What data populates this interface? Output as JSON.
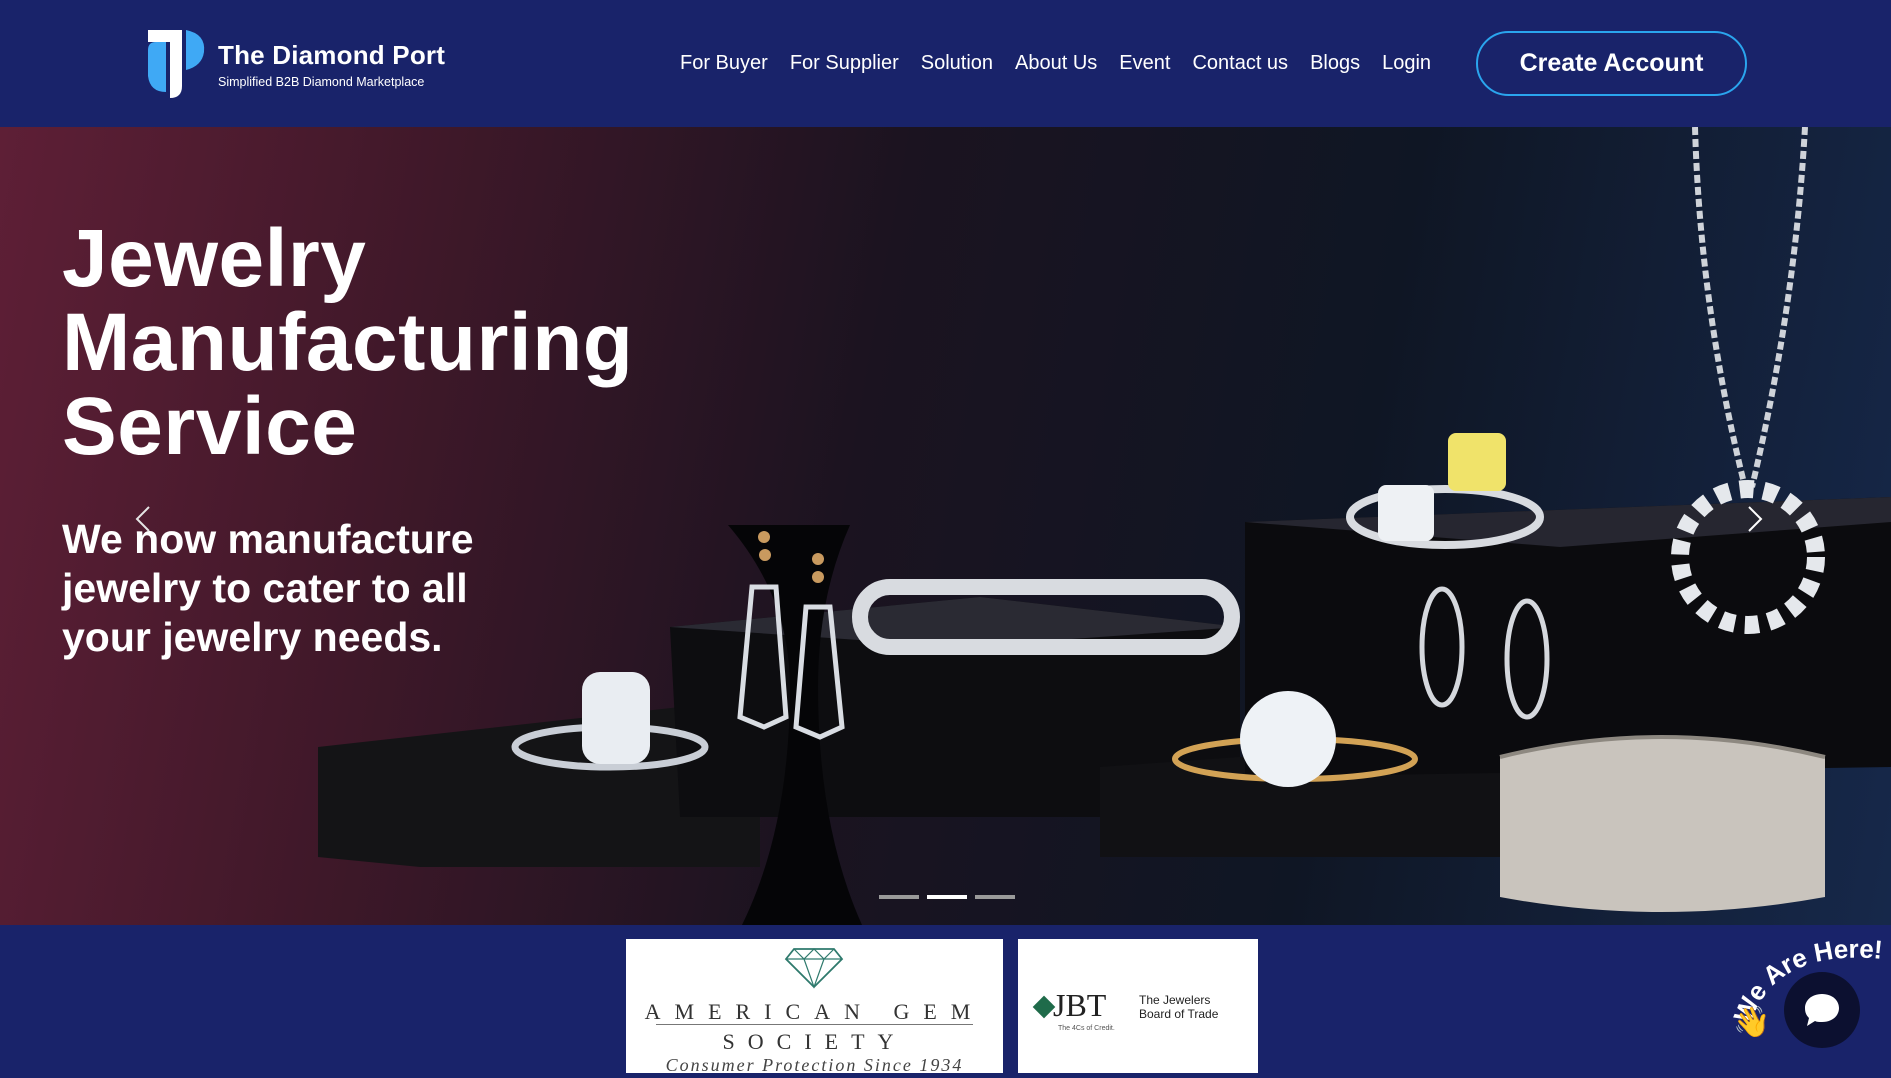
{
  "brand": {
    "name": "The Diamond Port",
    "tagline": "Simplified B2B Diamond Marketplace"
  },
  "nav": {
    "items": [
      "For Buyer",
      "For Supplier",
      "Solution",
      "About Us",
      "Event",
      "Contact us",
      "Blogs",
      "Login"
    ],
    "cta": "Create Account"
  },
  "hero": {
    "title_lines": [
      "Jewelry",
      "Manufacturing",
      "Service"
    ],
    "subtitle_lines": [
      "We now manufacture",
      "jewelry to cater to all",
      "your jewelry needs."
    ],
    "prev_icon": "chevron-left-icon",
    "next_icon": "chevron-right-icon",
    "slides_total": 3,
    "active_slide": 2
  },
  "partners": {
    "ags": {
      "line1": "AMERICAN GEM",
      "line2": "SOCIETY",
      "line3": "Consumer Protection Since 1934"
    },
    "jbt": {
      "mark": "JBT",
      "small": "The 4Cs of Credit.",
      "name": "The Jewelers Board of Trade"
    }
  },
  "chat": {
    "badge": "We Are Here!",
    "icon": "chat-bubble-icon"
  },
  "colors": {
    "header_bg": "#19236a",
    "cta_border": "#2aa5ee",
    "logo_blue": "#3fa9f5"
  }
}
